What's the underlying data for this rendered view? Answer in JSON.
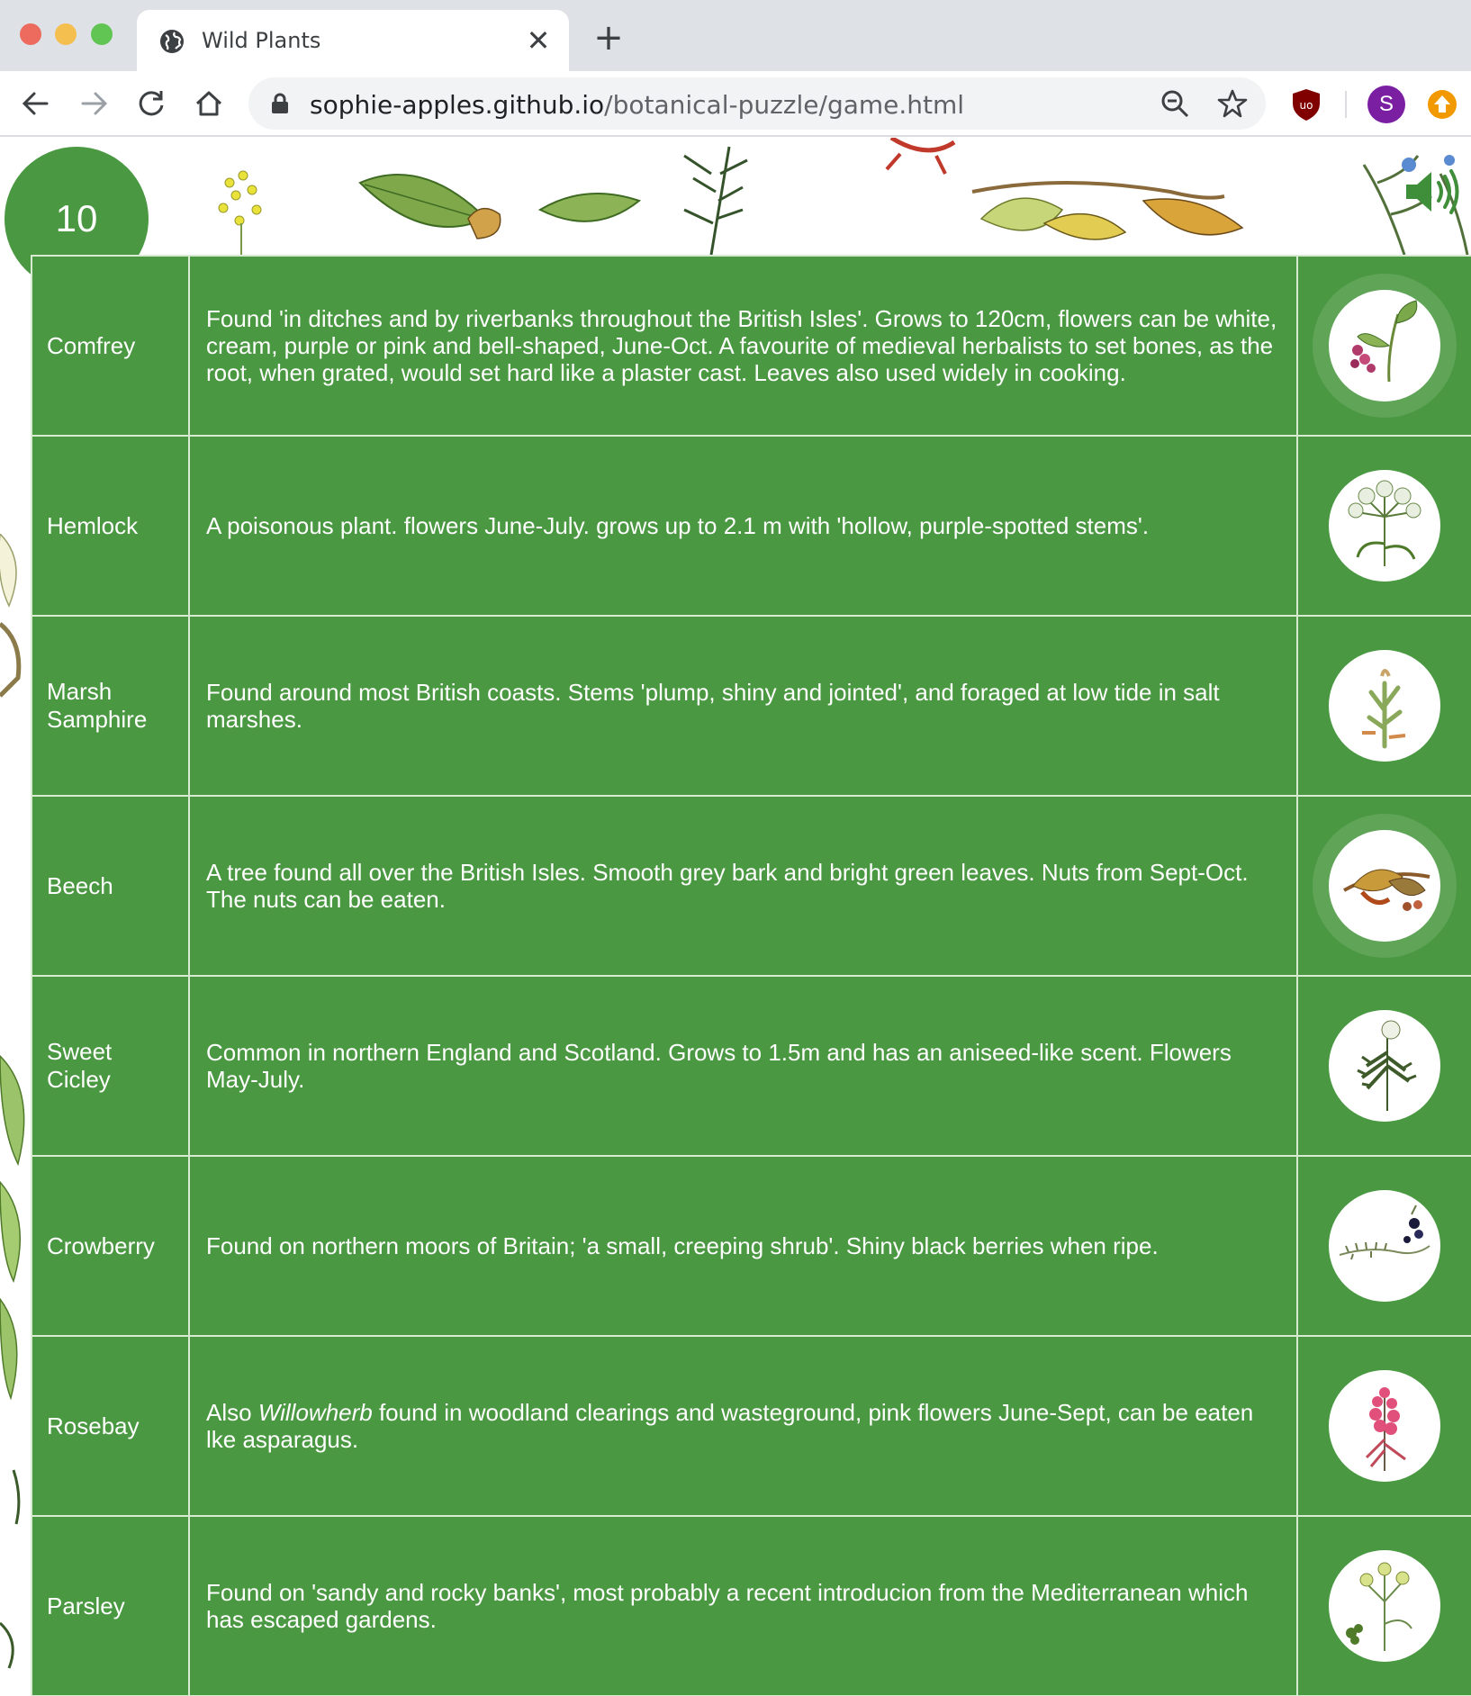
{
  "browser": {
    "tab_title": "Wild Plants",
    "close_glyph": "✕",
    "newtab_glyph": "+",
    "url_domain": "sophie-apples.github.io",
    "url_path": "/botanical-puzzle/game.html",
    "profile_initial": "S",
    "icons": [
      "globe-icon",
      "back-icon",
      "forward-icon",
      "reload-icon",
      "home-icon",
      "lock-icon",
      "zoom-icon",
      "star-icon",
      "ublock-icon",
      "profile-avatar",
      "extension-update-icon"
    ]
  },
  "game": {
    "score": "10",
    "sound_icon": "speaker-on-icon",
    "accent_color": "#4a9841",
    "plants": [
      {
        "name": "Comfrey",
        "description": "Found 'in ditches and by riverbanks throughout the British Isles'. Grows to 120cm, flowers can be white, cream, purple or pink and bell-shaped, June-Oct. A favourite of medieval herbalists to set bones, as the root, when grated, would set hard like a plaster cast. Leaves also used widely in cooking.",
        "image_icon": "comfrey-illustration"
      },
      {
        "name": "Hemlock",
        "description": "A poisonous plant. flowers June-July. grows up to 2.1 m with 'hollow, purple-spotted stems'.",
        "image_icon": "hemlock-illustration"
      },
      {
        "name": "Marsh Samphire",
        "description": "Found around most British coasts. Stems 'plump, shiny and jointed', and foraged at low tide in salt marshes.",
        "image_icon": "samphire-illustration"
      },
      {
        "name": "Beech",
        "description": "A tree found all over the British Isles. Smooth grey bark and bright green leaves. Nuts from Sept-Oct. The nuts can be eaten.",
        "image_icon": "beech-illustration"
      },
      {
        "name": "Sweet Cicley",
        "description": "Common in northern England and Scotland. Grows to 1.5m and has an aniseed-like scent. Flowers May-July.",
        "image_icon": "cicely-illustration"
      },
      {
        "name": "Crowberry",
        "description": "Found on northern moors of Britain; 'a small, creeping shrub'. Shiny black berries when ripe.",
        "image_icon": "crowberry-illustration"
      },
      {
        "name": "Rosebay",
        "desc_prefix": "Also ",
        "desc_italic": "Willowherb",
        "desc_suffix": " found in woodland clearings and wasteground, pink flowers June-Sept, can be eaten lke asparagus.",
        "image_icon": "rosebay-illustration"
      },
      {
        "name": "Parsley",
        "description": "Found on 'sandy and rocky banks', most probably a recent introducion from the Mediterranean which has escaped gardens.",
        "image_icon": "parsley-illustration"
      }
    ]
  }
}
